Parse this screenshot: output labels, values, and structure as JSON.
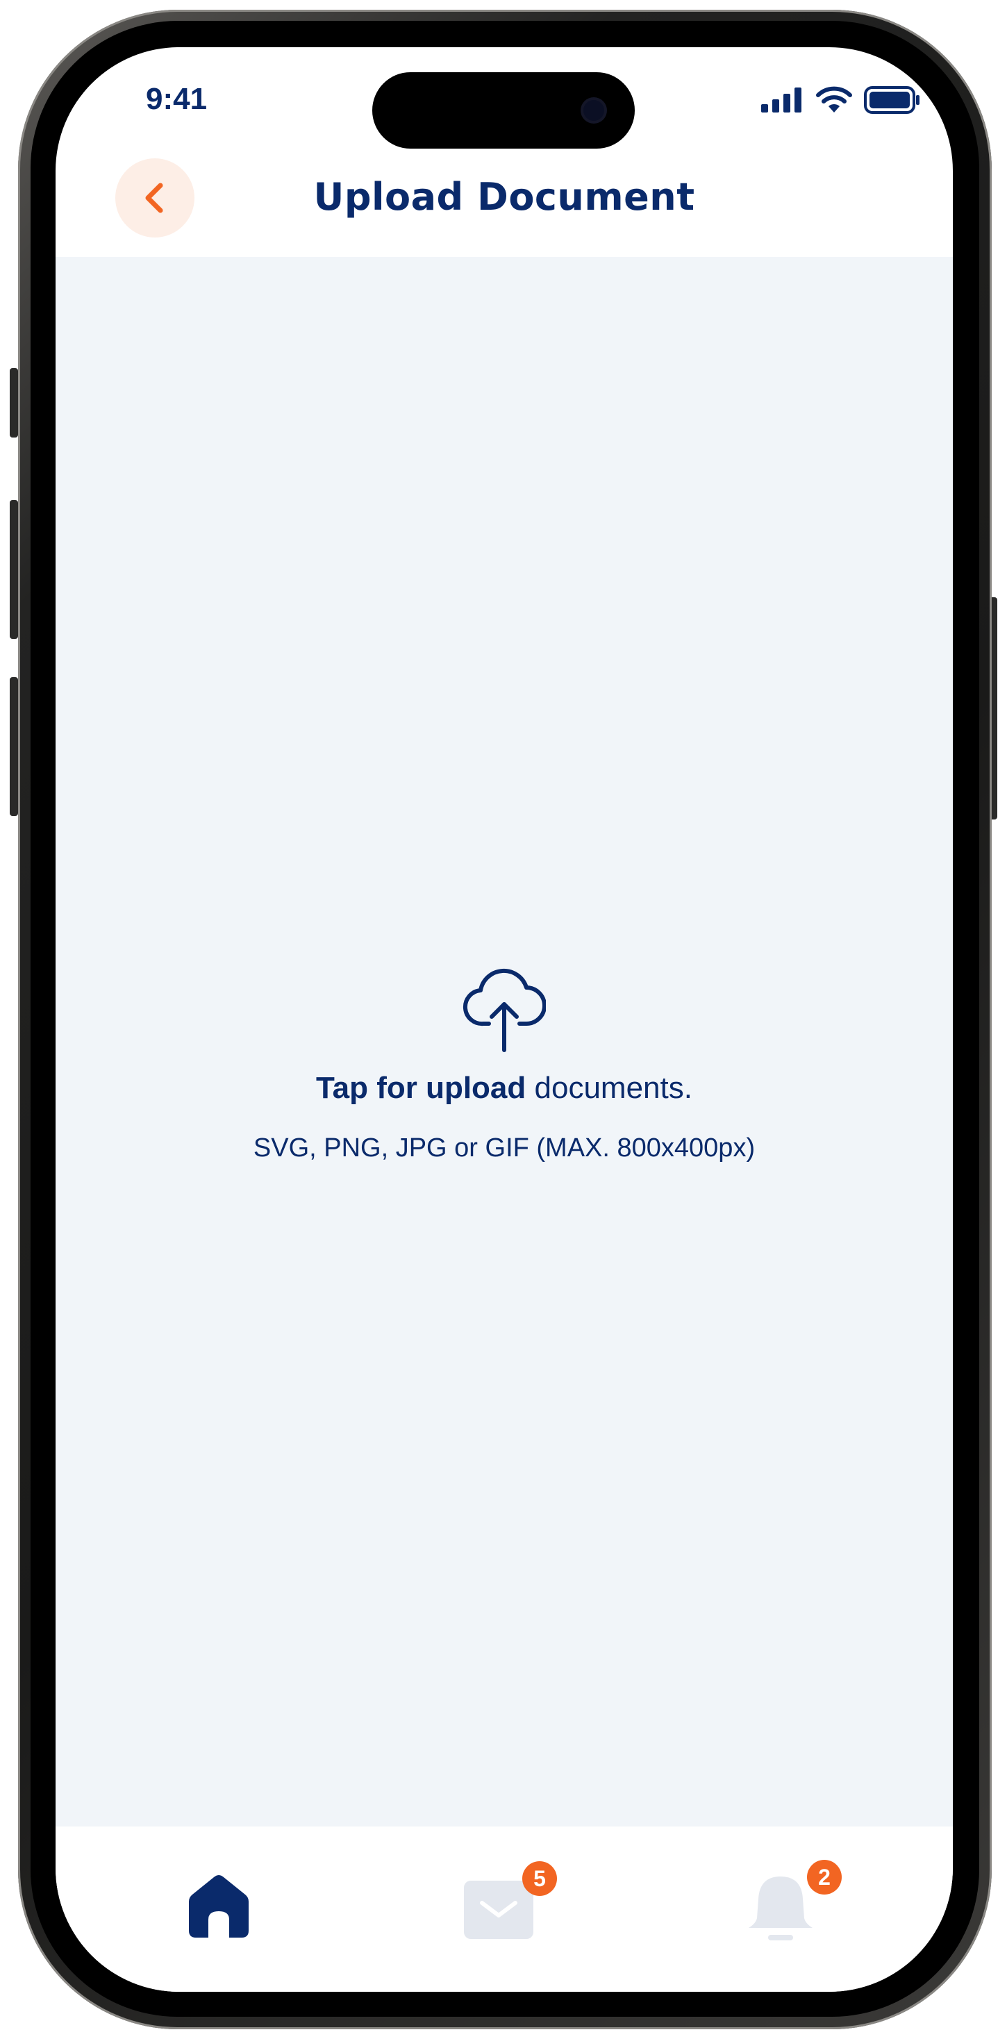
{
  "status_bar": {
    "time": "9:41",
    "icons": [
      "cellular-signal-icon",
      "wifi-icon",
      "battery-icon"
    ]
  },
  "header": {
    "title": "Upload Document",
    "back_icon": "chevron-left-icon"
  },
  "upload": {
    "icon": "cloud-upload-icon",
    "headline_strong": "Tap for upload",
    "headline_rest": " documents.",
    "hint": "SVG, PNG, JPG or GIF (MAX. 800x400px)"
  },
  "bottom_nav": {
    "items": [
      {
        "icon": "home-icon",
        "active": true
      },
      {
        "icon": "mail-icon",
        "badge": "5"
      },
      {
        "icon": "bell-icon",
        "badge": "2"
      }
    ]
  },
  "colors": {
    "primary": "#0a2a6b",
    "accent": "#f26522",
    "accent_soft": "#fdeee6",
    "surface": "#f1f5f9",
    "inactive_icon": "#e3e7ee"
  }
}
